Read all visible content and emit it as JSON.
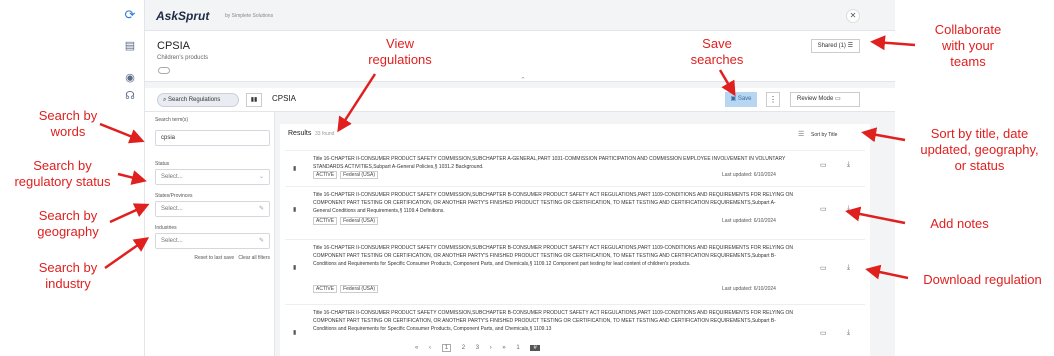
{
  "brand": {
    "name": "AskSprut",
    "sub": "by Simplete Solutions"
  },
  "header": {
    "title": "CPSIA",
    "subtitle": "Children's products",
    "shared": "Shared (1)"
  },
  "search_bar": {
    "search_regs": "Search Regulations",
    "query": "CPSIA",
    "save": "Save",
    "review_mode": "Review Mode"
  },
  "filters": {
    "search_terms_label": "Search term(s)",
    "search_terms_value": "cpsia",
    "status_label": "Status",
    "status_value": "Select...",
    "states_label": "States/Provinces",
    "states_value": "Select...",
    "industries_label": "Industries",
    "industries_value": "Select...",
    "reset": "Reset to last save",
    "clear": "Clear all filters"
  },
  "results": {
    "heading": "Results",
    "count": "33 found",
    "sort_label": "Sort by Title",
    "items": [
      {
        "title": "Title 16-CHAPTER II-CONSUMER PRODUCT SAFETY COMMISSION,SUBCHAPTER A-GENERAL,PART 1031-COMMISSION PARTICIPATION AND COMMISSION EMPLOYEE INVOLVEMENT IN VOLUNTARY STANDARDS ACTIVITIES,Subpart A-General Policies,§ 1031.2 Background.",
        "status": "ACTIVE",
        "jurisdiction": "Federal (USA)",
        "updated": "Last updated: 6/10/2024"
      },
      {
        "title": "Title 16-CHAPTER II-CONSUMER PRODUCT SAFETY COMMISSION,SUBCHAPTER B-CONSUMER PRODUCT SAFETY ACT REGULATIONS,PART 1109-CONDITIONS AND REQUIREMENTS FOR RELYING ON COMPONENT PART TESTING OR CERTIFICATION, OR ANOTHER PARTY'S FINISHED PRODUCT TESTING OR CERTIFICATION, TO MEET TESTING AND CERTIFICATION REQUIREMENTS,Subpart A-General Conditions and Requirements,§ 1109.4 Definitions.",
        "status": "ACTIVE",
        "jurisdiction": "Federal (USA)",
        "updated": "Last updated: 6/10/2024"
      },
      {
        "title": "Title 16-CHAPTER II-CONSUMER PRODUCT SAFETY COMMISSION,SUBCHAPTER B-CONSUMER PRODUCT SAFETY ACT REGULATIONS,PART 1109-CONDITIONS AND REQUIREMENTS FOR RELYING ON COMPONENT PART TESTING OR CERTIFICATION, OR ANOTHER PARTY'S FINISHED PRODUCT TESTING OR CERTIFICATION, TO MEET TESTING AND CERTIFICATION REQUIREMENTS,Subpart B-Conditions and Requirements for Specific Consumer Products, Component Parts, and Chemicals,§ 1109.12 Component part testing for lead content of children's products.",
        "status": "ACTIVE",
        "jurisdiction": "Federal (USA)",
        "updated": "Last updated: 6/10/2024"
      },
      {
        "title": "Title 16-CHAPTER II-CONSUMER PRODUCT SAFETY COMMISSION,SUBCHAPTER B-CONSUMER PRODUCT SAFETY ACT REGULATIONS,PART 1109-CONDITIONS AND REQUIREMENTS FOR RELYING ON COMPONENT PART TESTING OR CERTIFICATION, OR ANOTHER PARTY'S FINISHED PRODUCT TESTING OR CERTIFICATION, TO MEET TESTING AND CERTIFICATION REQUIREMENTS,Subpart B-Conditions and Requirements for Specific Consumer Products, Component Parts, and Chemicals,§ 1109.13",
        "status": "",
        "jurisdiction": "",
        "updated": ""
      }
    ]
  },
  "pagination": {
    "first": "«",
    "prev": "‹",
    "pages": [
      "1",
      "2",
      "3"
    ],
    "next": "›",
    "last": "»",
    "page_input": "1",
    "go": "#"
  },
  "annotations": {
    "view_regulations": "View\nregulations",
    "save_searches": "Save\nsearches",
    "collaborate": "Collaborate\nwith your\nteams",
    "search_words": "Search by\nwords",
    "search_status": "Search by\nregulatory status",
    "search_geo": "Search by\ngeography",
    "search_industry": "Search by\nindustry",
    "sort": "Sort by title, date\nupdated, geography,\nor status",
    "add_notes": "Add notes",
    "download": "Download regulation"
  },
  "colors": {
    "annotation": "#e01f1f",
    "save_button": "#b7d6f2",
    "brand": "#1f2b44"
  }
}
